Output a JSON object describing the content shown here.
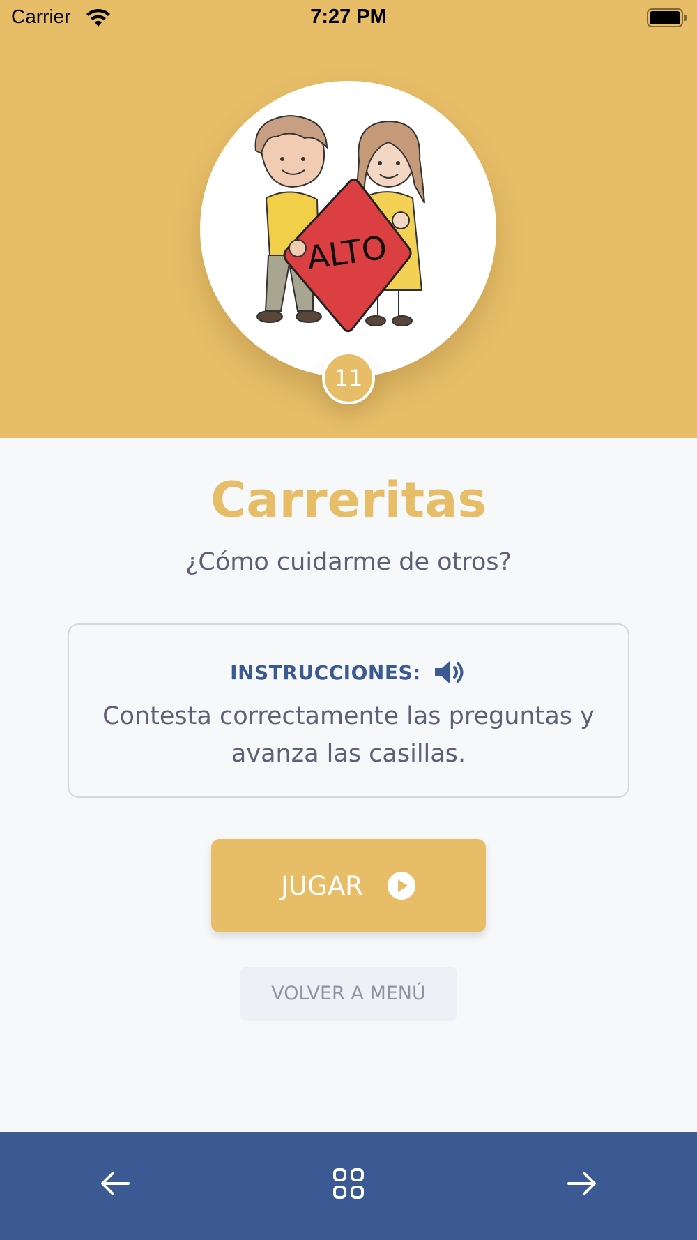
{
  "status_bar": {
    "carrier": "Carrier",
    "time": "7:27 PM",
    "wifi_icon": "wifi-icon",
    "battery_icon": "battery-icon"
  },
  "header": {
    "illustration": "children-holding-stop-sign",
    "sign_text": "ALTO",
    "level_number": "11"
  },
  "game": {
    "title": "Carreritas",
    "subtitle": "¿Cómo cuidarme de otros?"
  },
  "instructions": {
    "label": "INSTRUCCIONES:",
    "audio_icon": "speaker-icon",
    "text": "Contesta correctamente las preguntas y avanza las casillas."
  },
  "actions": {
    "play_label": "JUGAR",
    "play_icon": "play-circle-icon",
    "back_to_menu_label": "VOLVER A MENÚ"
  },
  "bottom_nav": {
    "prev_icon": "arrow-left-icon",
    "menu_icon": "grid-icon",
    "next_icon": "arrow-right-icon"
  },
  "colors": {
    "accent": "#e7bd68",
    "nav_blue": "#3b5a94",
    "text_gray": "#5c6275",
    "background": "#f7f8fa"
  }
}
